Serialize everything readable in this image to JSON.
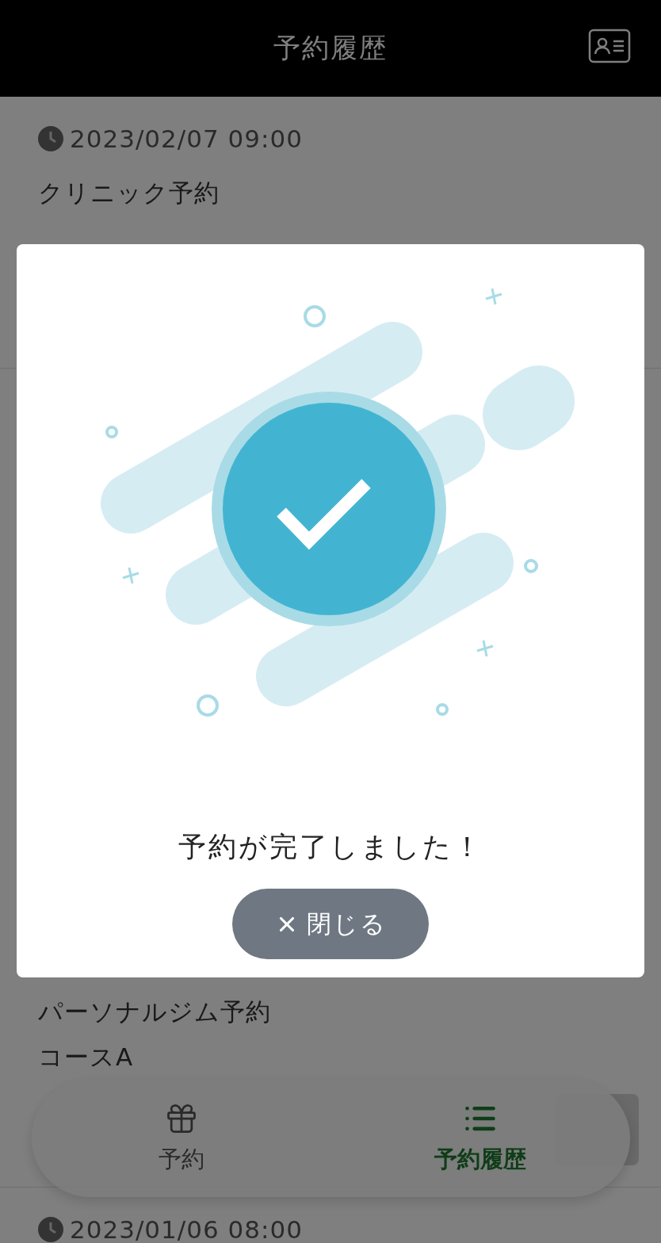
{
  "header": {
    "title": "予約履歴"
  },
  "history": [
    {
      "time": "2023/02/07 09:00",
      "title": "クリニック予約",
      "action": false
    },
    {
      "title": "パーソナルジム予約",
      "subtitle": "コースA",
      "action": true
    },
    {
      "time": "2023/01/06 08:00",
      "action": false
    }
  ],
  "tabs": [
    {
      "label": "予約",
      "selected": false
    },
    {
      "label": "予約履歴",
      "selected": true
    }
  ],
  "dialog": {
    "message": "予約が完了しました！",
    "button": "閉じる"
  }
}
